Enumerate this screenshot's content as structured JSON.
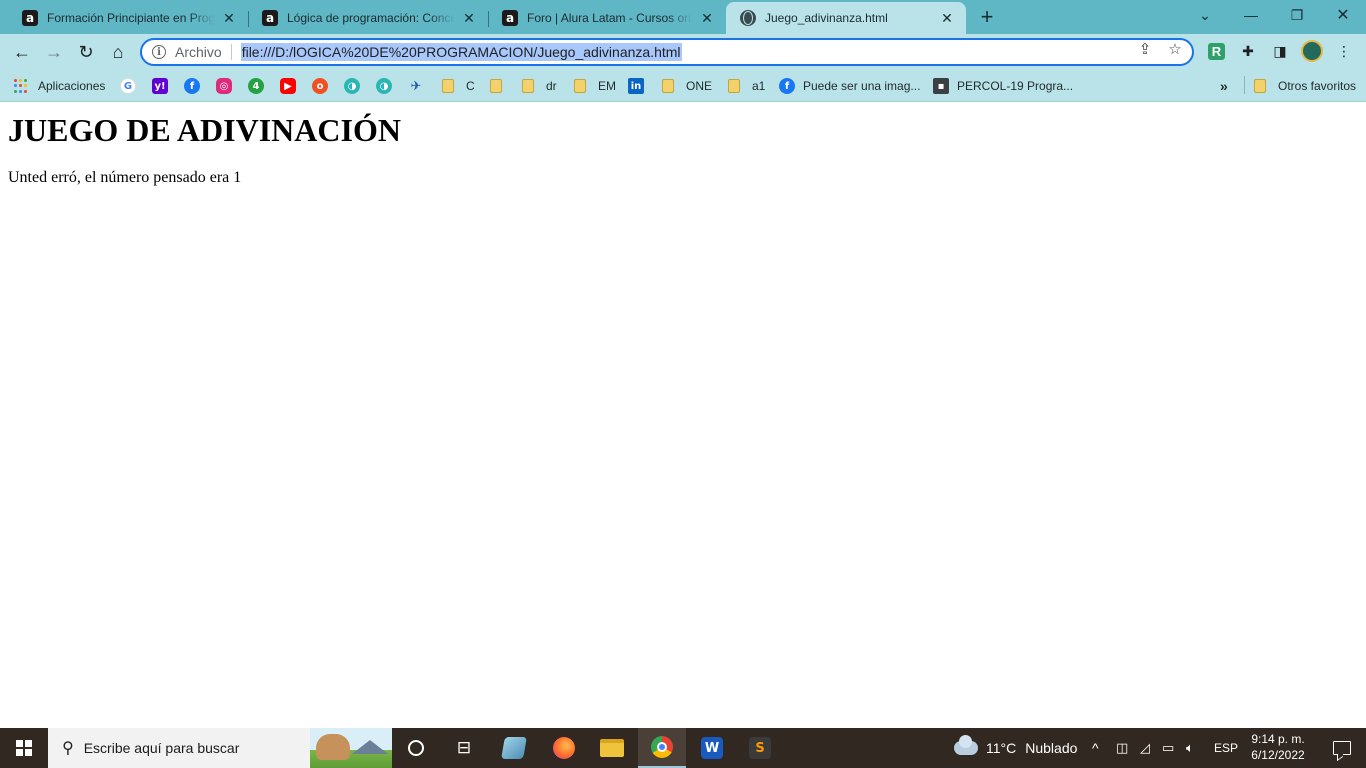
{
  "tabs": [
    {
      "title": "Formación Principiante en Programación",
      "favicon": "alura-a-icon"
    },
    {
      "title": "Lógica de programación: Conceptos",
      "favicon": "alura-a-icon"
    },
    {
      "title": "Foro | Alura Latam - Cursos online",
      "favicon": "alura-a-icon"
    },
    {
      "title": "Juego_adivinanza.html",
      "favicon": "globe-icon",
      "active": true
    }
  ],
  "address_bar": {
    "scheme_label": "Archivo",
    "url": "file:///D:/lOGICA%20DE%20PROGRAMACION/Juego_adivinanza.html"
  },
  "bookmarks": {
    "apps_label": "Aplicaciones",
    "items": [
      {
        "label": "",
        "icon": "google-icon",
        "color": "#4285f4"
      },
      {
        "label": "",
        "icon": "yahoo-icon",
        "color": "#6001d2"
      },
      {
        "label": "",
        "icon": "facebook-icon",
        "color": "#1877f2"
      },
      {
        "label": "",
        "icon": "instagram-icon",
        "color": "#dd2a7b"
      },
      {
        "label": "",
        "icon": "app-green-icon",
        "color": "#25a244"
      },
      {
        "label": "",
        "icon": "youtube-icon",
        "color": "#ff0000"
      },
      {
        "label": "",
        "icon": "app-orange-icon",
        "color": "#f25022"
      },
      {
        "label": "",
        "icon": "app-teal-icon",
        "color": "#2cb5b5"
      },
      {
        "label": "",
        "icon": "app-teal-icon",
        "color": "#2cb5b5"
      },
      {
        "label": "",
        "icon": "plane-icon",
        "color": "#1d5aa8"
      },
      {
        "label": "C",
        "icon": "folder-icon"
      },
      {
        "label": "",
        "icon": "folder-icon"
      },
      {
        "label": "dr",
        "icon": "folder-icon"
      },
      {
        "label": "EM",
        "icon": "folder-icon"
      },
      {
        "label": "",
        "icon": "linkedin-icon",
        "color": "#0a66c2"
      },
      {
        "label": "ONE",
        "icon": "folder-icon"
      },
      {
        "label": "a1",
        "icon": "folder-icon"
      },
      {
        "label": "Puede ser una imag...",
        "icon": "facebook-icon",
        "color": "#1877f2"
      },
      {
        "label": "PERCOL-19 Progra...",
        "icon": "contact-card-icon",
        "color": "#3c4043"
      }
    ],
    "overflow_label": "»",
    "other_label": "Otros favoritos"
  },
  "page": {
    "heading": "JUEGO DE ADIVINACIÓN",
    "message": "Unted erró, el número pensado era 1"
  },
  "taskbar": {
    "search_placeholder": "Escribe aquí para buscar",
    "weather_temp": "11°C",
    "weather_desc": "Nublado",
    "language": "ESP",
    "time": "9:14 p. m.",
    "date": "6/12/2022",
    "word_label": "W",
    "sublime_label": "S"
  },
  "colors": {
    "tabstrip": "#5fb6c4",
    "toolbar": "#b9e3e9",
    "taskbar": "#302821",
    "url_highlight": "#a8c7fa"
  }
}
